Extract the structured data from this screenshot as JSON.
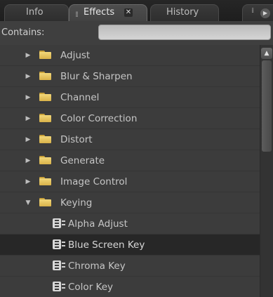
{
  "tabs": {
    "info": "Info",
    "effects": "Effects",
    "history": "History"
  },
  "search": {
    "label": "Contains:",
    "value": "",
    "placeholder": ""
  },
  "tree": [
    {
      "type": "folder",
      "label": "Adjust",
      "expanded": false
    },
    {
      "type": "folder",
      "label": "Blur & Sharpen",
      "expanded": false
    },
    {
      "type": "folder",
      "label": "Channel",
      "expanded": false
    },
    {
      "type": "folder",
      "label": "Color Correction",
      "expanded": false
    },
    {
      "type": "folder",
      "label": "Distort",
      "expanded": false
    },
    {
      "type": "folder",
      "label": "Generate",
      "expanded": false
    },
    {
      "type": "folder",
      "label": "Image Control",
      "expanded": false
    },
    {
      "type": "folder",
      "label": "Keying",
      "expanded": true
    },
    {
      "type": "effect",
      "label": "Alpha Adjust"
    },
    {
      "type": "effect",
      "label": "Blue Screen Key",
      "selected": true
    },
    {
      "type": "effect",
      "label": "Chroma Key"
    },
    {
      "type": "effect",
      "label": "Color Key"
    }
  ],
  "colors": {
    "panel_bg": "#3c3c3c",
    "selected_row": "#272727",
    "folder": "#e6c25e",
    "text": "#c6c6c6"
  },
  "icons": {
    "collapsed": "disclosure-triangle-right",
    "expanded": "disclosure-triangle-down",
    "folder": "folder-icon",
    "effect": "effect-icon",
    "close": "close-icon",
    "panel_menu": "panel-menu-icon"
  }
}
